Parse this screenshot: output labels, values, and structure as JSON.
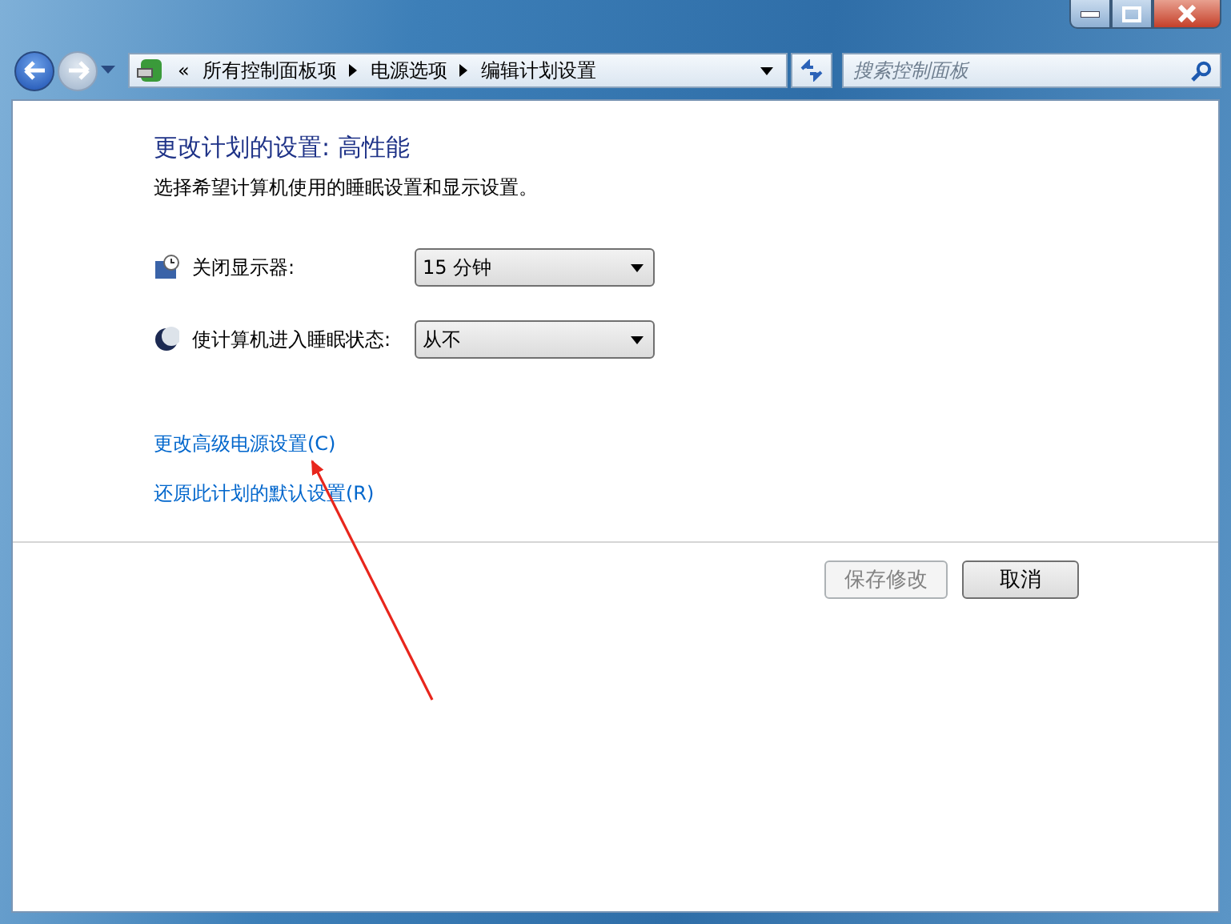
{
  "address_bar": {
    "overflow": "«",
    "breadcrumbs": [
      "所有控制面板项",
      "电源选项",
      "编辑计划设置"
    ]
  },
  "search": {
    "placeholder": "搜索控制面板"
  },
  "heading": "更改计划的设置: 高性能",
  "description": "选择希望计算机使用的睡眠设置和显示设置。",
  "settings": [
    {
      "kind": "display",
      "label": "关闭显示器:",
      "value": "15 分钟"
    },
    {
      "kind": "sleep",
      "label": "使计算机进入睡眠状态:",
      "value": "从不"
    }
  ],
  "links": [
    "更改高级电源设置(C)",
    "还原此计划的默认设置(R)"
  ],
  "buttons": [
    {
      "label": "保存修改",
      "disabled": true
    },
    {
      "label": "取消",
      "disabled": false
    }
  ]
}
